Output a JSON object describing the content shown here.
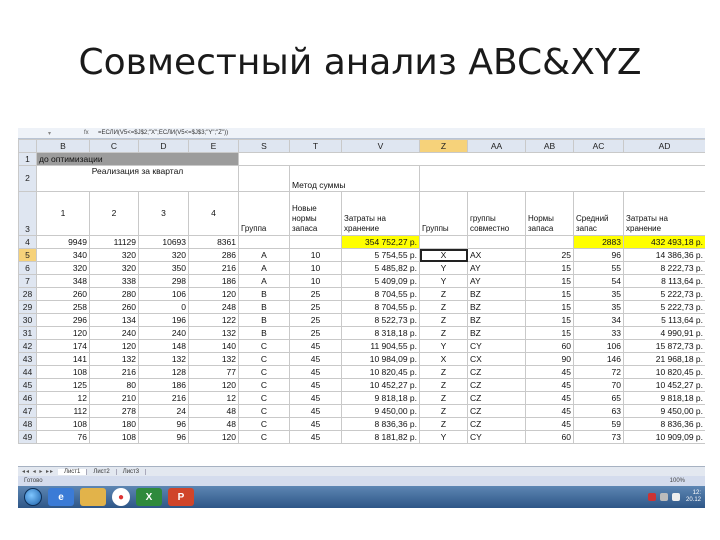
{
  "slide": {
    "title": "Совместный анализ ABC&XYZ"
  },
  "excel": {
    "formula": "=ЕСЛИ(V5<=$J$2;\"X\";ЕСЛИ(V5<=$J$3;\"Y\";\"Z\"))",
    "columns": [
      "B",
      "C",
      "D",
      "E",
      "S",
      "T",
      "V",
      "Z",
      "AA",
      "AB",
      "AC",
      "AD"
    ],
    "row1": {
      "num": "1",
      "text": "до оптимизации"
    },
    "row2": {
      "num": "2",
      "text": "Реализация за квартал",
      "metod": "Метод суммы"
    },
    "row3": {
      "num": "3",
      "q1": "1",
      "q2": "2",
      "q3": "3",
      "q4": "4",
      "gruppa": "Группа",
      "normy_novye": "Новые нормы запаса",
      "zatraty": "Затраты на хранение",
      "gruppy": "Группы",
      "gruppy_sovm": "группы совместно",
      "normy": "Нормы запаса",
      "sredniy": "Средний запас",
      "zatraty2": "Затраты на хранение"
    },
    "row4": {
      "num": "4",
      "b": "9949",
      "c": "11129",
      "d": "10693",
      "e": "8361",
      "v": "354 752,27 р.",
      "ac": "2883",
      "ad": "432 493,18 р."
    },
    "rows": [
      {
        "num": "5",
        "b": "340",
        "c": "320",
        "d": "320",
        "e": "286",
        "s": "A",
        "t": "10",
        "v": "5 754,55 р.",
        "z": "X",
        "aa": "AX",
        "ab": "25",
        "ac": "96",
        "ad": "14 386,36 р."
      },
      {
        "num": "6",
        "b": "320",
        "c": "320",
        "d": "350",
        "e": "216",
        "s": "A",
        "t": "10",
        "v": "5 485,82 р.",
        "z": "Y",
        "aa": "AY",
        "ab": "15",
        "ac": "55",
        "ad": "8 222,73 р."
      },
      {
        "num": "7",
        "b": "348",
        "c": "338",
        "d": "298",
        "e": "186",
        "s": "A",
        "t": "10",
        "v": "5 409,09 р.",
        "z": "Y",
        "aa": "AY",
        "ab": "15",
        "ac": "54",
        "ad": "8 113,64 р."
      },
      {
        "num": "28",
        "b": "260",
        "c": "280",
        "d": "106",
        "e": "120",
        "s": "B",
        "t": "25",
        "v": "8 704,55 р.",
        "z": "Z",
        "aa": "BZ",
        "ab": "15",
        "ac": "35",
        "ad": "5 222,73 р."
      },
      {
        "num": "29",
        "b": "258",
        "c": "260",
        "d": "0",
        "e": "248",
        "s": "B",
        "t": "25",
        "v": "8 704,55 р.",
        "z": "Z",
        "aa": "BZ",
        "ab": "15",
        "ac": "35",
        "ad": "5 222,73 р."
      },
      {
        "num": "30",
        "b": "296",
        "c": "134",
        "d": "196",
        "e": "122",
        "s": "B",
        "t": "25",
        "v": "8 522,73 р.",
        "z": "Z",
        "aa": "BZ",
        "ab": "15",
        "ac": "34",
        "ad": "5 113,64 р."
      },
      {
        "num": "31",
        "b": "120",
        "c": "240",
        "d": "240",
        "e": "132",
        "s": "B",
        "t": "25",
        "v": "8 318,18 р.",
        "z": "Z",
        "aa": "BZ",
        "ab": "15",
        "ac": "33",
        "ad": "4 990,91 р."
      },
      {
        "num": "42",
        "b": "174",
        "c": "120",
        "d": "148",
        "e": "140",
        "s": "C",
        "t": "45",
        "v": "11 904,55 р.",
        "z": "Y",
        "aa": "CY",
        "ab": "60",
        "ac": "106",
        "ad": "15 872,73 р."
      },
      {
        "num": "43",
        "b": "141",
        "c": "132",
        "d": "132",
        "e": "132",
        "s": "C",
        "t": "45",
        "v": "10 984,09 р.",
        "z": "X",
        "aa": "CX",
        "ab": "90",
        "ac": "146",
        "ad": "21 968,18 р."
      },
      {
        "num": "44",
        "b": "108",
        "c": "216",
        "d": "128",
        "e": "77",
        "s": "C",
        "t": "45",
        "v": "10 820,45 р.",
        "z": "Z",
        "aa": "CZ",
        "ab": "45",
        "ac": "72",
        "ad": "10 820,45 р."
      },
      {
        "num": "45",
        "b": "125",
        "c": "80",
        "d": "186",
        "e": "120",
        "s": "C",
        "t": "45",
        "v": "10 452,27 р.",
        "z": "Z",
        "aa": "CZ",
        "ab": "45",
        "ac": "70",
        "ad": "10 452,27 р."
      },
      {
        "num": "46",
        "b": "12",
        "c": "210",
        "d": "216",
        "e": "12",
        "s": "C",
        "t": "45",
        "v": "9 818,18 р.",
        "z": "Z",
        "aa": "CZ",
        "ab": "45",
        "ac": "65",
        "ad": "9 818,18 р."
      },
      {
        "num": "47",
        "b": "112",
        "c": "278",
        "d": "24",
        "e": "48",
        "s": "C",
        "t": "45",
        "v": "9 450,00 р.",
        "z": "Z",
        "aa": "CZ",
        "ab": "45",
        "ac": "63",
        "ad": "9 450,00 р."
      },
      {
        "num": "48",
        "b": "108",
        "c": "180",
        "d": "96",
        "e": "48",
        "s": "C",
        "t": "45",
        "v": "8 836,36 р.",
        "z": "Z",
        "aa": "CZ",
        "ab": "45",
        "ac": "59",
        "ad": "8 836,36 р."
      },
      {
        "num": "49",
        "b": "76",
        "c": "108",
        "d": "96",
        "e": "120",
        "s": "C",
        "t": "45",
        "v": "8 181,82 р.",
        "z": "Y",
        "aa": "CY",
        "ab": "60",
        "ac": "73",
        "ad": "10 909,09 р."
      }
    ],
    "sheet_tabs": [
      "Лист1",
      "Лист2",
      "Лист3"
    ],
    "status_text": "Готово",
    "zoom": "100%"
  },
  "taskbar": {
    "clock_time": "12:",
    "clock_date": "20.12"
  }
}
